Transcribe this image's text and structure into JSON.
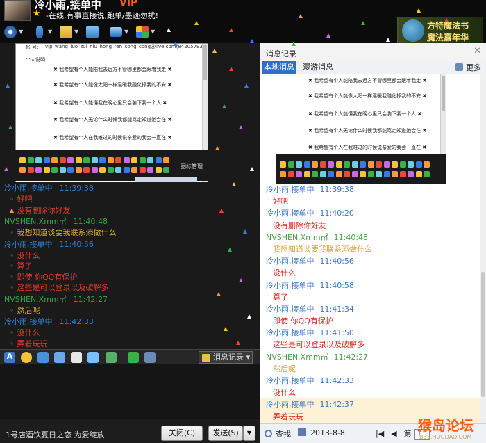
{
  "window": {
    "title": "冷小雨,接单中",
    "vip_badge": "VIP",
    "signature": "-在线,有事直接说,跑单/墨迹勿扰!",
    "ad_lines": [
      "方特魔法书",
      "魔法嘉年华"
    ]
  },
  "toolbar": {
    "icons": [
      "camera-icon",
      "microphone-icon",
      "folder-icon",
      "add-chat-icon",
      "screen-share-icon",
      "apps-icon"
    ]
  },
  "pasted_screenshot": {
    "account_label": "帐 号:",
    "account_value": "vip_wang_luo_zui_niu_hong_ren_cong_cong@live.com(8420579341)",
    "profile_label": "个人说明",
    "lines": [
      "✖ 我希望有个人能陪我去远方不管哪里都会跟着我走 ✖",
      "✖ 我希望有个人能像太阳一样温暖我融化掉我的不安 ✖",
      "✖ 我希望有个人能懂我在晚心里只会装下我一个人 ✖",
      "✖ 我希望有个人无论什么时候我都能笃定知道她会在 ✖",
      "✖ 我希望有个人在我难过的时候说亲爱的我会一直在 ✖"
    ],
    "emoji_label": "图标管理"
  },
  "chat": {
    "messages": [
      {
        "sender": "冷小雨,接单中",
        "time": "11:39:38",
        "role": "self",
        "lines": [
          "好吧",
          "没有删除你好友"
        ]
      },
      {
        "sender": "NVSHEN.Xmm㎡",
        "time": "11:40:48",
        "role": "other",
        "lines": [
          "我想知道谈要我联系添做什么"
        ]
      },
      {
        "sender": "冷小雨,接单中",
        "time": "11:40:56",
        "role": "self",
        "lines": [
          "没什么",
          "算了",
          "即使 你QQ有保护",
          "这些是可以登录以及破解多"
        ]
      },
      {
        "sender": "NVSHEN.Xmm㎡",
        "time": "11:42:27",
        "role": "other",
        "lines": [
          "然后呢"
        ]
      },
      {
        "sender": "冷小雨,接单中",
        "time": "11:42:33",
        "role": "self",
        "lines": [
          "没什么",
          "弄着玩玩"
        ]
      }
    ]
  },
  "chat_toolbar": {
    "history_button": "消息记录"
  },
  "bottom_bar": {
    "status_text": "1号店酒饮夏日之恋 为爱绽放",
    "close_button": "关闭(C)",
    "send_button": "发送(S)"
  },
  "history_panel": {
    "title": "消息记录",
    "tabs": [
      "本地消息",
      "漫游消息"
    ],
    "more": "更多",
    "entries": [
      {
        "sender": "冷小雨,接单中",
        "time": "11:39:38",
        "role": "self",
        "text": "好吧"
      },
      {
        "sender": "冷小雨,接单中",
        "time": "11:40:20",
        "role": "self",
        "text": "没有删除你好友"
      },
      {
        "sender": "NVSHEN.Xmm㎡",
        "time": "11:40:48",
        "role": "other",
        "text": "我想知道谈要我联系添做什么"
      },
      {
        "sender": "冷小雨,接单中",
        "time": "11:40:56",
        "role": "self",
        "text": "没什么"
      },
      {
        "sender": "冷小雨,接单中",
        "time": "11:40:58",
        "role": "self",
        "text": "算了"
      },
      {
        "sender": "冷小雨,接单中",
        "time": "11:41:34",
        "role": "self",
        "text": "即使 你QQ有保护"
      },
      {
        "sender": "冷小雨,接单中",
        "time": "11:41:50",
        "role": "self",
        "text": "这些是可以登录以及破解多"
      },
      {
        "sender": "NVSHEN.Xmm㎡",
        "time": "11:42:27",
        "role": "other",
        "text": "然后呢"
      },
      {
        "sender": "冷小雨,接单中",
        "time": "11:42:33",
        "role": "self",
        "text": "没什么"
      },
      {
        "sender": "冷小雨,接单中",
        "time": "11:42:37",
        "role": "self",
        "text": "弄着玩玩"
      }
    ],
    "search_label": "查找",
    "date": "2013-8-8",
    "page_label": "第",
    "page_number": "1"
  },
  "watermark": {
    "main": "猴岛论坛",
    "sub": "BBS.HOUDAO.COM"
  },
  "colors": {
    "self_name": "#2f7fd6",
    "self_text": "#e23b2b",
    "other_name": "#3aa04a",
    "other_text": "#d9a63a",
    "history_self_name": "#3b77c4",
    "history_self_text": "#d8261c",
    "history_other_name": "#4aa04a",
    "history_other_text": "#d6a33a",
    "highlight": "#fdf1d6"
  }
}
